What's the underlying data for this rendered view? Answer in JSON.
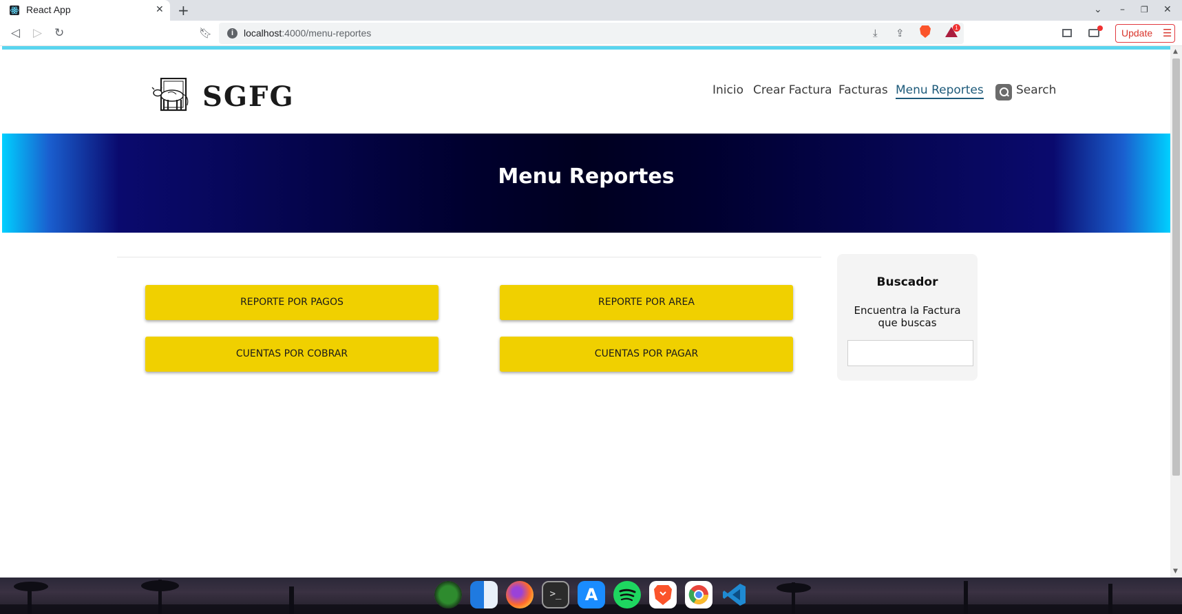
{
  "browser": {
    "tab_title": "React App",
    "tab_close": "✕",
    "new_tab": "+",
    "url_host": "localhost",
    "url_path": ":4000/menu-reportes",
    "update_label": "Update",
    "bat_badge": "1"
  },
  "site": {
    "logo_text": "SGFG",
    "nav": {
      "inicio": "Inicio",
      "crear_factura": "Crear Factura",
      "facturas": "Facturas",
      "menu_reportes": "Menu Reportes",
      "search": "Search"
    },
    "hero_title": "Menu Reportes",
    "buttons": {
      "reporte_pagos": "REPORTE POR PAGOS",
      "reporte_area": "REPORTE POR AREA",
      "cuentas_cobrar": "CUENTAS POR COBRAR",
      "cuentas_pagar": "CUENTAS POR PAGAR"
    },
    "buscador": {
      "title": "Buscador",
      "description": "Encuentra la Factura que buscas",
      "input_value": ""
    }
  },
  "colors": {
    "button_yellow": "#f0d000",
    "hero_dark": "#000020",
    "hero_edge": "#00d0ff",
    "top_strip": "#5ad5ef",
    "active_nav": "#1d5a7a"
  },
  "dock": {
    "apps": [
      "system-monitor-icon",
      "finder-icon",
      "firefox-icon",
      "terminal-icon",
      "app-store-icon",
      "spotify-icon",
      "brave-icon",
      "chromium-icon",
      "vscode-icon"
    ]
  }
}
